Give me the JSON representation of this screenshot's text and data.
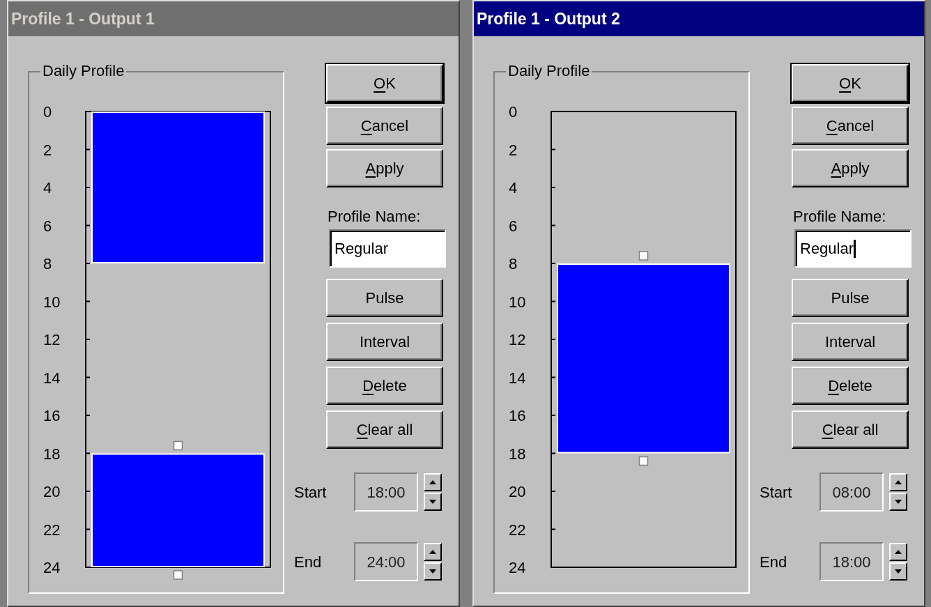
{
  "dialogs": [
    {
      "title": "Profile 1 - Output 1",
      "active": false,
      "group_label": "Daily Profile",
      "segments": [
        {
          "on": true,
          "selected": false,
          "hour_labels": [
            "0",
            "2",
            "4",
            "6"
          ]
        },
        {
          "on": false,
          "hour_labels": [
            "8",
            "10",
            "12",
            "14",
            "16"
          ]
        },
        {
          "on": true,
          "selected": true,
          "hour_labels": [
            "18",
            "20",
            "22"
          ]
        }
      ],
      "end_label": "24",
      "top_buttons": [
        {
          "label": "OK",
          "default": true,
          "accelerator": true
        },
        {
          "label": "Cancel",
          "default": false,
          "accelerator": true
        },
        {
          "label": "Apply",
          "default": false,
          "accelerator": true
        }
      ],
      "profile_name": {
        "label": "Profile Name:",
        "value": "Regular",
        "focused": false
      },
      "action_buttons": [
        {
          "label": "Pulse",
          "accelerator": false
        },
        {
          "label": "Interval",
          "accelerator": false
        },
        {
          "label": "Delete",
          "accelerator": true
        },
        {
          "label": "Clear all",
          "accelerator": true
        }
      ],
      "times": [
        {
          "label": "Start",
          "value": "18:00"
        },
        {
          "label": "End",
          "value": "24:00"
        }
      ]
    },
    {
      "title": "Profile 1 - Output 2",
      "active": true,
      "group_label": "Daily Profile",
      "segments": [
        {
          "on": false,
          "hour_labels": [
            "0",
            "2",
            "4",
            "6"
          ]
        },
        {
          "on": true,
          "selected": true,
          "hour_labels": [
            "8",
            "10",
            "12",
            "14",
            "16"
          ]
        },
        {
          "on": false,
          "hour_labels": [
            "18",
            "20",
            "22"
          ]
        }
      ],
      "end_label": "24",
      "top_buttons": [
        {
          "label": "OK",
          "default": true,
          "accelerator": true
        },
        {
          "label": "Cancel",
          "default": false,
          "accelerator": true
        },
        {
          "label": "Apply",
          "default": false,
          "accelerator": true
        }
      ],
      "profile_name": {
        "label": "Profile Name:",
        "value": "Regular",
        "focused": true
      },
      "action_buttons": [
        {
          "label": "Pulse",
          "accelerator": false
        },
        {
          "label": "Interval",
          "accelerator": false
        },
        {
          "label": "Delete",
          "accelerator": true
        },
        {
          "label": "Clear all",
          "accelerator": true
        }
      ],
      "times": [
        {
          "label": "Start",
          "value": "08:00"
        },
        {
          "label": "End",
          "value": "18:00"
        }
      ]
    }
  ]
}
